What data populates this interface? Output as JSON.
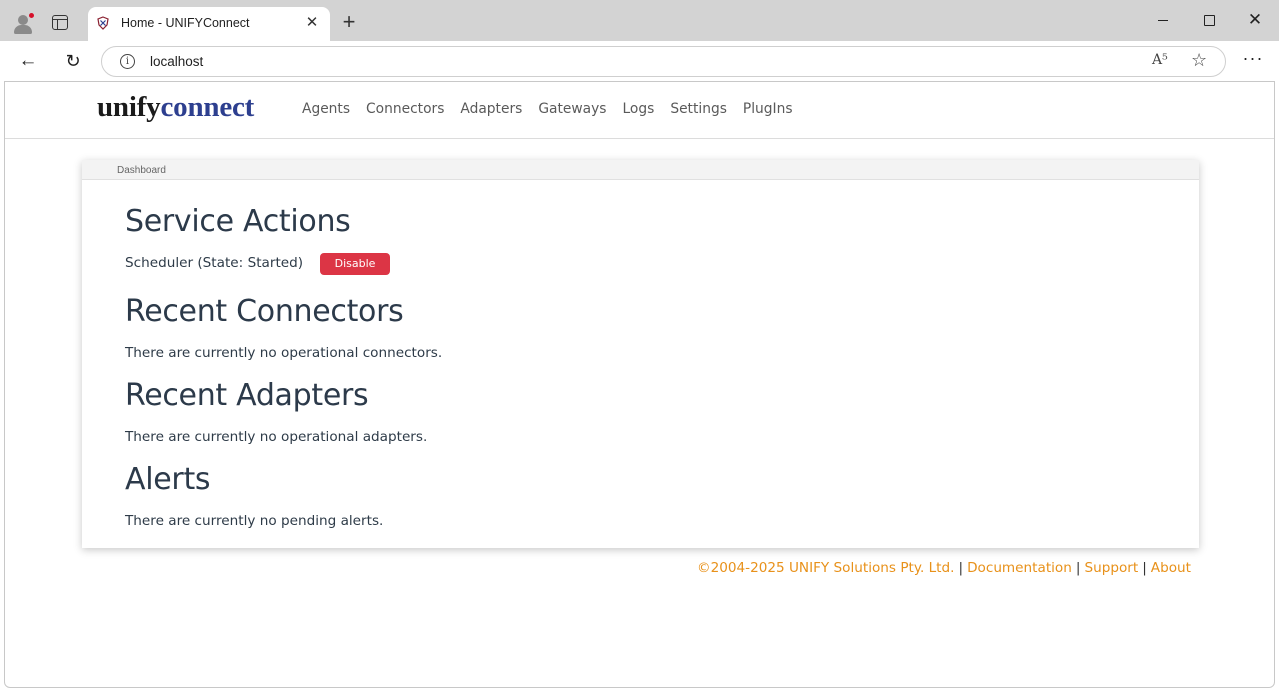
{
  "browser": {
    "tab_title": "Home - UNIFYConnect",
    "tab_close": "✕",
    "new_tab": "+",
    "url": "localhost",
    "more": "···"
  },
  "brand": {
    "part1": "unify",
    "part2": "connect",
    "colors": {
      "part1": "#1b1b1b",
      "part2": "#2d3f8f"
    }
  },
  "nav": {
    "links": [
      "Agents",
      "Connectors",
      "Adapters",
      "Gateways",
      "Logs",
      "Settings",
      "PlugIns"
    ]
  },
  "breadcrumb": "Dashboard",
  "service_actions": {
    "title": "Service Actions",
    "scheduler_label": "Scheduler (State: Started)",
    "disable_label": "Disable"
  },
  "recent_connectors": {
    "title": "Recent Connectors",
    "message": "There are currently no operational connectors."
  },
  "recent_adapters": {
    "title": "Recent Adapters",
    "message": "There are currently no operational adapters."
  },
  "alerts": {
    "title": "Alerts",
    "message": "There are currently no pending alerts."
  },
  "footer": {
    "copyright": "©2004-2025 UNIFY Solutions Pty. Ltd.",
    "separator": "|",
    "documentation": "Documentation",
    "support": "Support",
    "about": "About",
    "link_color": "#e8911a"
  },
  "colors": {
    "danger": "#dc3545",
    "heading": "#2c3a4a"
  }
}
